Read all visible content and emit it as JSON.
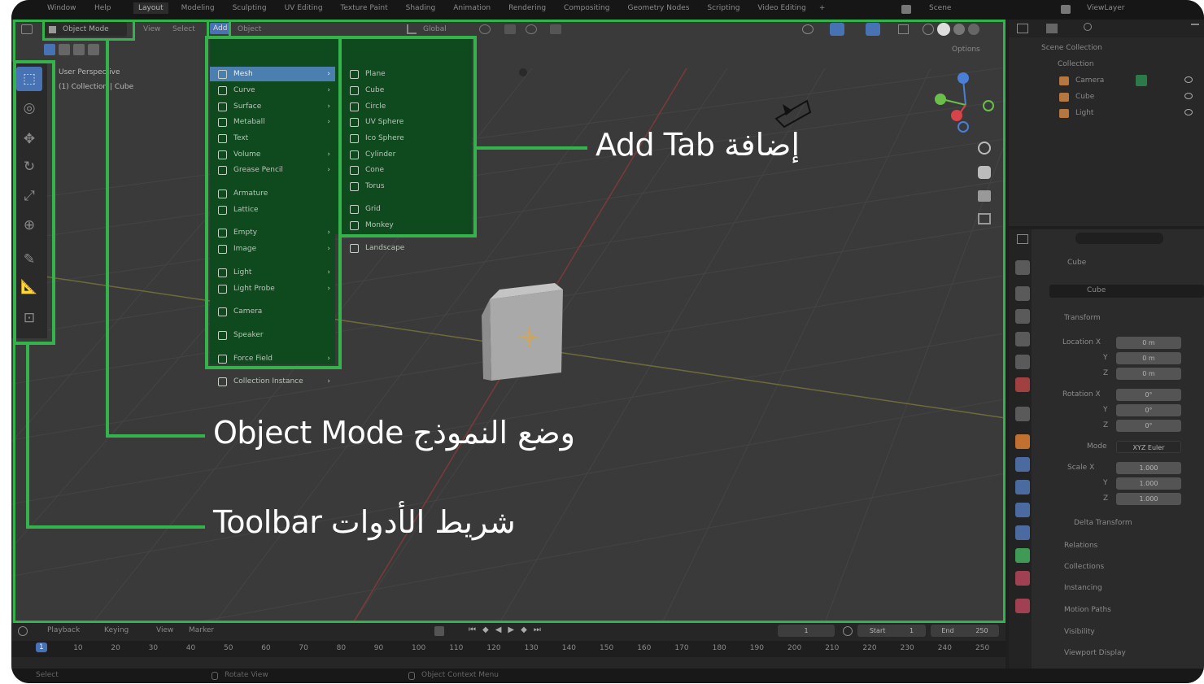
{
  "topbar": {
    "menus": [
      "Window",
      "Help"
    ],
    "workspaces": [
      "Layout",
      "Modeling",
      "Sculpting",
      "UV Editing",
      "Texture Paint",
      "Shading",
      "Animation",
      "Rendering",
      "Compositing",
      "Geometry Nodes",
      "Scripting",
      "Video Editing"
    ],
    "add_workspace": "+",
    "scene": "Scene",
    "view_layer": "ViewLayer"
  },
  "viewport_header": {
    "mode": "Object Mode",
    "menus": [
      "View",
      "Select",
      "Add",
      "Object"
    ],
    "transform_orientation": "Global",
    "options": "Options"
  },
  "viewport_info": {
    "line1": "User Perspective",
    "line2": "(1) Collection | Cube"
  },
  "add_menu": {
    "col1": [
      {
        "label": "Mesh",
        "icon": "mesh-icon",
        "submenu": true,
        "highlighted": true
      },
      {
        "label": "Curve",
        "icon": "curve-icon",
        "submenu": true
      },
      {
        "label": "Surface",
        "icon": "surface-icon",
        "submenu": true
      },
      {
        "label": "Metaball",
        "icon": "metaball-icon",
        "submenu": true
      },
      {
        "label": "Text",
        "icon": "text-icon",
        "submenu": false
      },
      {
        "label": "Volume",
        "icon": "volume-icon",
        "submenu": true
      },
      {
        "label": "Grease Pencil",
        "icon": "grease-pencil-icon",
        "submenu": true
      },
      {
        "label": "Armature",
        "icon": "armature-icon",
        "submenu": false
      },
      {
        "label": "Lattice",
        "icon": "lattice-icon",
        "submenu": false
      },
      {
        "label": "Empty",
        "icon": "empty-icon",
        "submenu": true
      },
      {
        "label": "Image",
        "icon": "image-icon",
        "submenu": true
      },
      {
        "label": "Light",
        "icon": "light-icon",
        "submenu": true
      },
      {
        "label": "Light Probe",
        "icon": "light-probe-icon",
        "submenu": true
      },
      {
        "label": "Camera",
        "icon": "camera-icon",
        "submenu": false
      },
      {
        "label": "Speaker",
        "icon": "speaker-icon",
        "submenu": false
      },
      {
        "label": "Force Field",
        "icon": "force-field-icon",
        "submenu": true
      },
      {
        "label": "Collection Instance",
        "icon": "collection-instance-icon",
        "submenu": true
      }
    ],
    "col2": [
      {
        "label": "Plane",
        "icon": "plane-icon"
      },
      {
        "label": "Cube",
        "icon": "cube-icon"
      },
      {
        "label": "Circle",
        "icon": "circle-icon"
      },
      {
        "label": "UV Sphere",
        "icon": "uv-sphere-icon"
      },
      {
        "label": "Ico Sphere",
        "icon": "ico-sphere-icon"
      },
      {
        "label": "Cylinder",
        "icon": "cylinder-icon"
      },
      {
        "label": "Cone",
        "icon": "cone-icon"
      },
      {
        "label": "Torus",
        "icon": "torus-icon"
      },
      {
        "label": "Grid",
        "icon": "grid-icon"
      },
      {
        "label": "Monkey",
        "icon": "monkey-icon"
      },
      {
        "label": "Landscape",
        "icon": "landscape-icon"
      }
    ]
  },
  "annotations": {
    "add_tab": "Add Tab إضافة",
    "object_mode": "Object Mode وضع النموذج",
    "toolbar": "Toolbar شريط الأدوات"
  },
  "outliner": {
    "root": "Scene Collection",
    "collection": "Collection",
    "items": [
      "Camera",
      "Cube",
      "Light"
    ]
  },
  "properties": {
    "object_name": "Cube",
    "data_name": "Cube",
    "transform_header": "Transform",
    "location_label": "Location X",
    "location": [
      "0 m",
      "0 m",
      "0 m"
    ],
    "rotation_label": "Rotation X",
    "rotation": [
      "0°",
      "0°",
      "0°"
    ],
    "mode_label": "Mode",
    "mode_value": "XYZ Euler",
    "scale_label": "Scale X",
    "scale": [
      "1.000",
      "1.000",
      "1.000"
    ],
    "axis_y": "Y",
    "axis_z": "Z",
    "panels": [
      "Delta Transform",
      "Relations",
      "Collections",
      "Instancing",
      "Motion Paths",
      "Visibility",
      "Viewport Display"
    ]
  },
  "timeline": {
    "menus": [
      "Playback",
      "Keying",
      "View",
      "Marker"
    ],
    "current_frame": "1",
    "start_label": "Start",
    "start_value": "1",
    "end_label": "End",
    "end_value": "250",
    "ruler": [
      "1",
      "10",
      "20",
      "30",
      "40",
      "50",
      "60",
      "70",
      "80",
      "90",
      "100",
      "110",
      "120",
      "130",
      "140",
      "150",
      "160",
      "170",
      "180",
      "190",
      "200",
      "210",
      "220",
      "230",
      "240",
      "250"
    ]
  },
  "statusbar": {
    "select": "Select",
    "rotate_view": "Rotate View",
    "context_menu": "Object Context Menu"
  },
  "colors": {
    "highlight_green": "#34b34a",
    "menu_green": "#0f4a1e",
    "viewport_bg": "#3a3a3a",
    "active_blue": "#4772b3"
  }
}
